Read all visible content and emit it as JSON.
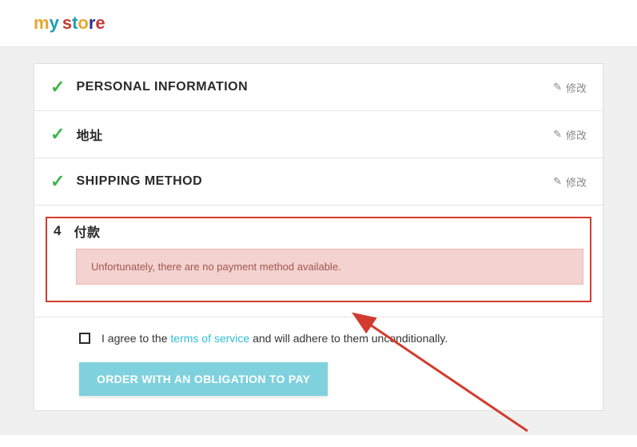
{
  "logo": {
    "part1": "my",
    "part2": "store"
  },
  "steps": {
    "personal": {
      "title": "PERSONAL INFORMATION",
      "edit": "修改"
    },
    "address": {
      "title": "地址",
      "edit": "修改"
    },
    "shipping": {
      "title": "SHIPPING METHOD",
      "edit": "修改"
    },
    "payment": {
      "num": "4",
      "title": "付款",
      "alert": "Unfortunately, there are no payment method available."
    }
  },
  "agree": {
    "pre": "I agree to the ",
    "link": "terms of service",
    "post": " and will adhere to them unconditionally."
  },
  "button": "ORDER WITH AN OBLIGATION TO PAY"
}
